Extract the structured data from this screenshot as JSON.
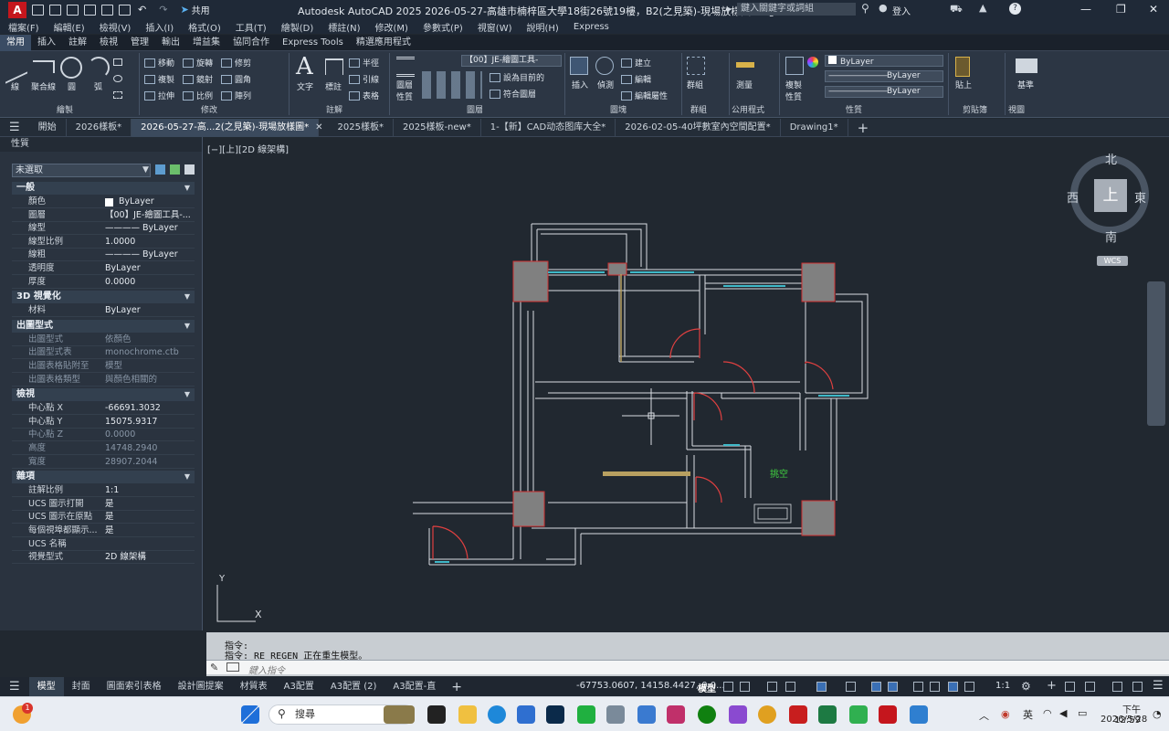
{
  "app": {
    "logo": "A",
    "share": "共用",
    "title": "Autodesk AutoCAD 2025    2026-05-27-高雄市楠梓區大學18街26號19樓，B2(之見築)-現場放樣圖.dwg",
    "search_placeholder": "鍵入關鍵字或詞組",
    "login": "登入",
    "help": "?"
  },
  "menu": [
    "檔案(F)",
    "編輯(E)",
    "檢視(V)",
    "插入(I)",
    "格式(O)",
    "工具(T)",
    "繪製(D)",
    "標註(N)",
    "修改(M)",
    "參數式(P)",
    "視窗(W)",
    "說明(H)",
    "Express"
  ],
  "ribbon_tabs": [
    "常用",
    "插入",
    "註解",
    "檢視",
    "管理",
    "輸出",
    "增益集",
    "協同合作",
    "Express Tools",
    "精選應用程式"
  ],
  "ribbon": {
    "draw": {
      "label": "繪製",
      "tools": [
        "線",
        "聚合線",
        "圓",
        "弧"
      ]
    },
    "modify": {
      "label": "修改",
      "tools": [
        "移動",
        "旋轉",
        "修剪",
        "複製",
        "鏡射",
        "圓角",
        "拉伸",
        "比例",
        "陣列"
      ]
    },
    "annotation": {
      "label": "註解",
      "tools": [
        "文字",
        "標註",
        "半徑",
        "引線",
        "表格"
      ]
    },
    "layers": {
      "label": "圖層",
      "tools": [
        "圖層性質",
        "設為目前的",
        "符合圖層"
      ],
      "current": "【00】JE-繪圖工具-"
    },
    "block": {
      "label": "圖塊",
      "tools": [
        "插入",
        "偵測",
        "建立",
        "編輯",
        "編輯屬性"
      ]
    },
    "groups": {
      "label": "群組",
      "tools": [
        "群組"
      ]
    },
    "utilities": {
      "label": "公用程式",
      "tools": [
        "測量"
      ]
    },
    "properties": {
      "label": "性質",
      "tools": [
        "複製性質"
      ],
      "color": "ByLayer",
      "linetype": "ByLayer",
      "lineweight": "ByLayer"
    },
    "clipboard": {
      "label": "剪貼簿",
      "tools": [
        "貼上"
      ]
    },
    "view": {
      "label": "視圖",
      "tools": [
        "基準"
      ]
    }
  },
  "doc_tabs": [
    "開始",
    "2026樣板*",
    "2026-05-27-高...2(之見築)-現場放樣圖*",
    "2025樣板*",
    "2025樣板-new*",
    "1-【新】CAD动态图库大全*",
    "2026-02-05-40坪數室內空間配置*",
    "Drawing1*"
  ],
  "properties": {
    "title": "性質",
    "selection": "未選取",
    "sections": [
      {
        "name": "一般",
        "rows": [
          [
            "顏色",
            "ByLayer"
          ],
          [
            "圖層",
            "【00】JE-繪圖工具-..."
          ],
          [
            "線型",
            "———— ByLayer"
          ],
          [
            "線型比例",
            "1.0000"
          ],
          [
            "線粗",
            "———— ByLayer"
          ],
          [
            "透明度",
            "ByLayer"
          ],
          [
            "厚度",
            "0.0000"
          ]
        ]
      },
      {
        "name": "3D 視覺化",
        "rows": [
          [
            "材料",
            "ByLayer"
          ]
        ]
      },
      {
        "name": "出圖型式",
        "rows": [
          [
            "出圖型式",
            "依顏色"
          ],
          [
            "出圖型式表",
            "monochrome.ctb"
          ],
          [
            "出圖表格貼附至",
            "模型"
          ],
          [
            "出圖表格類型",
            "與顏色相關的"
          ]
        ]
      },
      {
        "name": "檢視",
        "rows": [
          [
            "中心點 X",
            "-66691.3032"
          ],
          [
            "中心點 Y",
            "15075.9317"
          ],
          [
            "中心點 Z",
            "0.0000"
          ],
          [
            "高度",
            "14748.2940"
          ],
          [
            "寬度",
            "28907.2044"
          ]
        ]
      },
      {
        "name": "雜項",
        "rows": [
          [
            "註解比例",
            "1:1"
          ],
          [
            "UCS 圖示打開",
            "是"
          ],
          [
            "UCS 圖示在原點",
            "是"
          ],
          [
            "每個視埠都顯示...",
            "是"
          ],
          [
            "UCS 名稱",
            ""
          ],
          [
            "視覺型式",
            "2D 線架構"
          ]
        ]
      }
    ]
  },
  "viewport": {
    "label": "[−][上][2D 線架構]",
    "compass": {
      "n": "北",
      "s": "南",
      "e": "東",
      "w": "西",
      "top": "上",
      "wcs": "WCS"
    },
    "room_label": "挑空",
    "ucs_x": "X",
    "ucs_y": "Y"
  },
  "command": {
    "line1": "指令:",
    "line2": "指令: RE REGEN 正在重生模型。",
    "placeholder": "鍵入指令"
  },
  "status": {
    "layouts": [
      "模型",
      "封面",
      "圖面索引表格",
      "設計圖提案",
      "材質表",
      "A3配置",
      "A3配置 (2)",
      "A3配置-直"
    ],
    "coords": "-67753.0607, 14158.4427, 0.0...",
    "model": "模型",
    "scale": "1:1"
  },
  "taskbar": {
    "search": "搜尋",
    "lang": "英",
    "time": "下午 12:59",
    "date": "2026/5/28",
    "badge": "1"
  },
  "colors": {
    "wall": "#d9dde2",
    "column": "#808080",
    "window": "#3fb8c8",
    "door": "#e04040",
    "furniture": "#b8a060",
    "label": "#40d040"
  }
}
